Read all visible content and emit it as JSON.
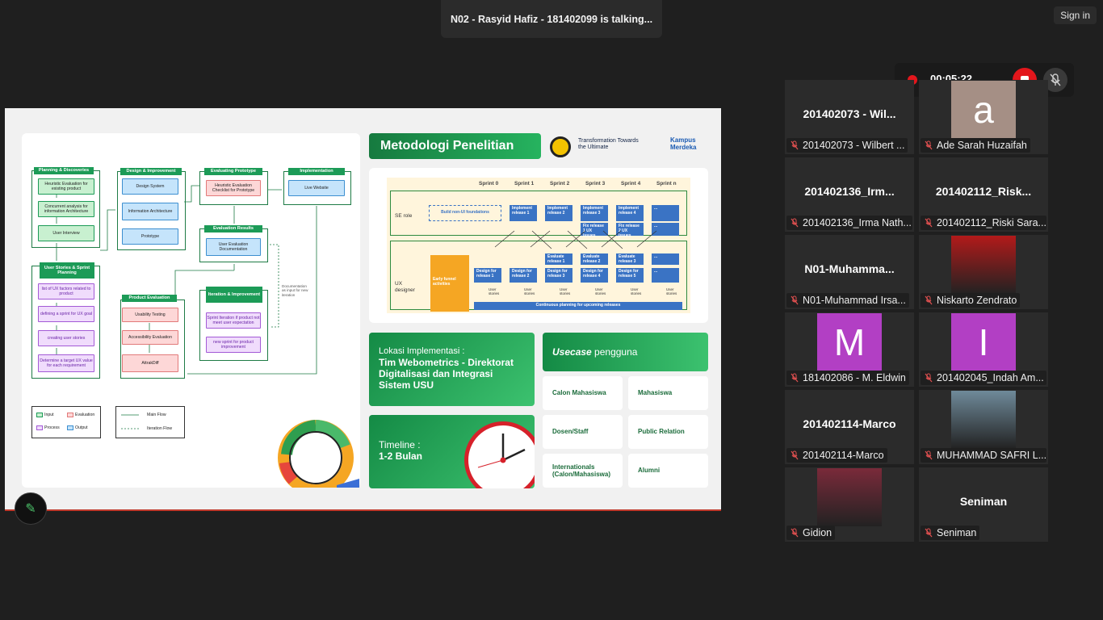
{
  "meeting": {
    "talking_banner": "N02 - Rasyid Hafiz - 181402099 is talking...",
    "sign_in": "Sign in",
    "timer": "00:05:22"
  },
  "slide": {
    "title": "Metodologi Penelitian",
    "partner_logo_text": "Transformation Towards the Ultimate",
    "kampus_logo_text": "Kampus Merdeka",
    "flow": {
      "groups": {
        "planning": "Planning & Discoveries",
        "design": "Design & Improvement",
        "eval_proto": "Evaluating Prototype",
        "implementation": "Implementation",
        "eval_results": "Evaluation Results",
        "user_stories": "User Stories & Sprint Planning",
        "product_eval": "Product Evaluation",
        "iteration": "Iteration & Improvement"
      },
      "boxes": {
        "heuristic_existing": "Heuristic Evaluation for existing product",
        "concurrent": "Concurrent analysis for information Architecture",
        "user_interview": "User Interview",
        "design_system": "Design System",
        "info_arch": "Information Architecture",
        "prototype": "Prototype",
        "heuristic_checklist": "Heuristic Evaluation Checklist for Prototype",
        "live_website": "Live Website",
        "ue_doc": "User Evaluation Documentation",
        "list_ux": "list of UX factors related to product",
        "define_sprint": "defining a sprint for UX goal",
        "create_stories": "creating user stories",
        "target_ux": "Determine a target UX value for each requirement",
        "usability": "Usability Testing",
        "accessibility": "Accessibility Evaluation",
        "attrakdiff": "AttrakDiff",
        "sprint_iter": "Sprint Iteration if product not meet user expectation",
        "new_sprint": "new sprint for product improvement",
        "doc_note": "Documentation as input for new iteration"
      },
      "legend": {
        "input": "Input",
        "evaluation": "Evaluation",
        "process": "Process",
        "output": "Output",
        "main_flow": "Main Flow",
        "iteration_flow": "Iteration Flow"
      }
    },
    "sprint": {
      "headers": [
        "Sprint 0",
        "Sprint 1",
        "Sprint 2",
        "Sprint 3",
        "Sprint 4",
        "Sprint n"
      ],
      "se_role": "SE role",
      "ux_designer": "UX designer",
      "build_non_ui": "Build non-UI foundations",
      "early_funnel": "Early funnel activities",
      "implement": [
        "Implement release 1",
        "Implement release 2",
        "Implement release 3",
        "Implement release 4"
      ],
      "fix": [
        "Fix release 1 UX issues",
        "Fix release 2 UX issues"
      ],
      "evaluate": [
        "Evaluate release 1",
        "Evaluate release 2",
        "Evaluate release 3"
      ],
      "design_for": [
        "Design for release 1",
        "Design for release 2",
        "Design for release 3",
        "Design for release 4",
        "Design for release 5"
      ],
      "ellipsis": "...",
      "user_stories": "User stories",
      "continuous": "Continuous planning for upcoming releases"
    },
    "location": {
      "label": "Lokasi Implementasi :",
      "value": "Tim Webometrics - Direktorat Digitalisasi dan Integrasi Sistem USU"
    },
    "timeline": {
      "label": "Timeline :",
      "value": "1-2 Bulan"
    },
    "usecase": {
      "title_italic": "Usecase",
      "title_rest": " pengguna",
      "items": [
        "Calon Mahasiswa",
        "Mahasiswa",
        "Dosen/Staff",
        "Public Relation",
        "Internationals (Calon/Mahasiswa)",
        "Alumni"
      ]
    }
  },
  "participants": [
    {
      "display": "201402073 - Wil...",
      "label": "201402073 - Wilbert ...",
      "kind": "text"
    },
    {
      "display": "a",
      "label": "Ade Sarah Huzaifah",
      "kind": "letter",
      "color": "#a58f85"
    },
    {
      "display": "201402136_Irm...",
      "label": "201402136_Irma Nath...",
      "kind": "text"
    },
    {
      "display": "201402112_Risk...",
      "label": "201402112_Riski Sara...",
      "kind": "text"
    },
    {
      "display": "N01-Muhamma...",
      "label": "N01-Muhammad Irsa...",
      "kind": "text"
    },
    {
      "display": "",
      "label": "Niskarto Zendrato",
      "kind": "photo",
      "color": "#b21a1a"
    },
    {
      "display": "M",
      "label": "181402086 - M. Eldwin",
      "kind": "letter",
      "color": "#b23fc4"
    },
    {
      "display": "I",
      "label": "201402045_Indah Am...",
      "kind": "letter",
      "color": "#b23fc4"
    },
    {
      "display": "201402114-Marco",
      "label": "201402114-Marco",
      "kind": "text"
    },
    {
      "display": "",
      "label": "MUHAMMAD SAFRI L...",
      "kind": "photo",
      "color": "#6f8a9a"
    },
    {
      "display": "",
      "label": "Gidion",
      "kind": "photo",
      "color": "#7a2a3a"
    },
    {
      "display": "Seniman",
      "label": "Seniman",
      "kind": "text"
    }
  ]
}
